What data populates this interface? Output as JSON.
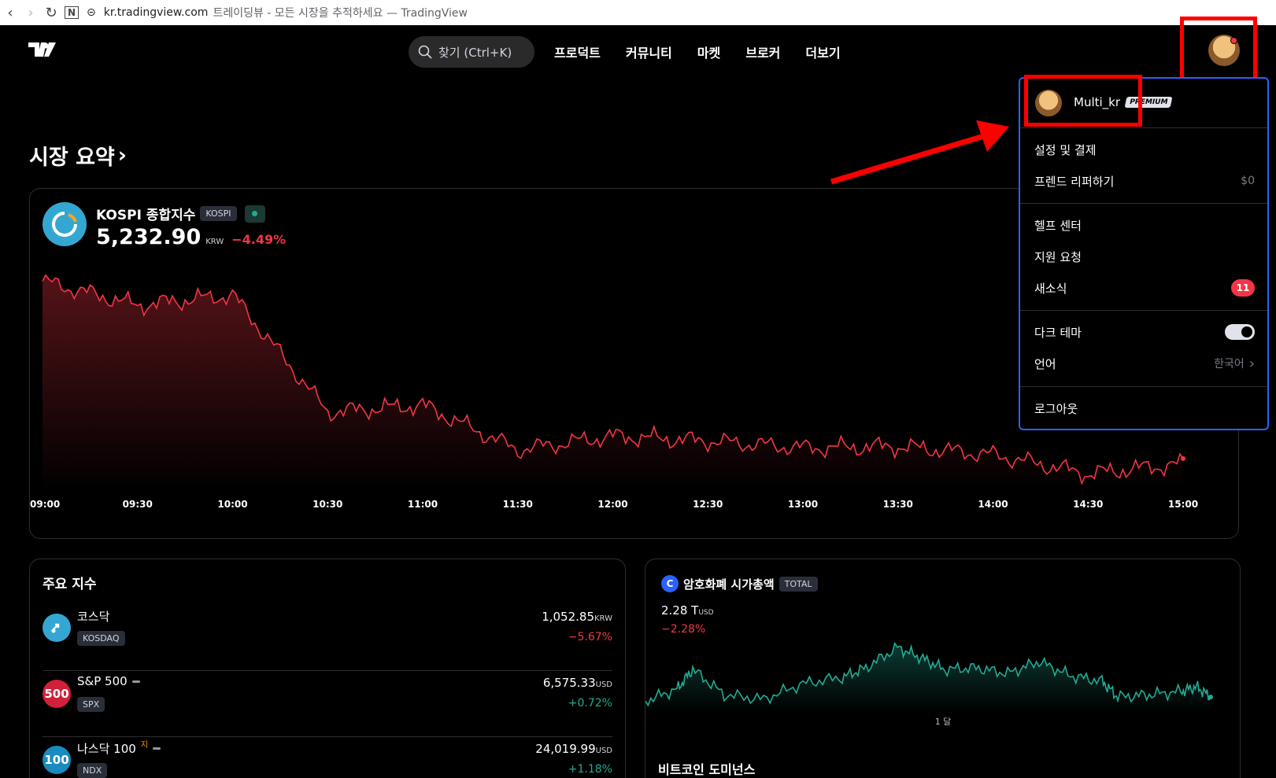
{
  "browser": {
    "domain": "kr.tradingview.com",
    "title": "트레이딩뷰 - 모든 시장을 추적하세요 — TradingView"
  },
  "nav": {
    "search_placeholder": "찾기 (Ctrl+K)",
    "links": [
      "프로덕트",
      "커뮤니티",
      "마켓",
      "브로커",
      "더보기"
    ]
  },
  "page": {
    "title": "시장 요약",
    "title_chevron": "›"
  },
  "main_index": {
    "name": "KOSPI 종합지수",
    "ticker": "KOSPI",
    "price": "5,232.90",
    "currency": "KRW",
    "change": "−4.49%"
  },
  "chart_data": [
    {
      "type": "area",
      "name": "KOSPI intraday",
      "x": [
        "09:00",
        "09:30",
        "10:00",
        "10:30",
        "11:00",
        "11:30",
        "12:00",
        "12:30",
        "13:00",
        "13:30",
        "14:00",
        "14:30",
        "15:00"
      ],
      "y": [
        5480,
        5445,
        5460,
        5290,
        5300,
        5235,
        5255,
        5248,
        5238,
        5240,
        5228,
        5200,
        5215
      ],
      "color": "#f23645"
    },
    {
      "type": "area",
      "name": "Crypto total market cap",
      "x_label": "1 달",
      "color": "#22ab94"
    }
  ],
  "indices": {
    "title": "주요 지수",
    "rows": [
      {
        "name": "코스닥",
        "ticker": "KOSDAQ",
        "price": "1,052.85",
        "currency": "KRW",
        "change": "−5.67%",
        "dir": "neg",
        "icon_text": "",
        "icon_color": "#33a7d2"
      },
      {
        "name": "S&P 500",
        "ticker": "SPX",
        "price": "6,575.33",
        "currency": "USD",
        "change": "+0.72%",
        "dir": "pos",
        "icon_text": "500",
        "icon_color": "#d1203a"
      },
      {
        "name": "나스닥 100",
        "ticker": "NDX",
        "price": "24,019.99",
        "currency": "USD",
        "change": "+1.18%",
        "dir": "pos",
        "icon_text": "100",
        "icon_color": "#1a8bbf",
        "sup": "지"
      }
    ]
  },
  "crypto": {
    "title": "암호화폐 시가총액",
    "ticker": "TOTAL",
    "value": "2.28 T",
    "currency": "USD",
    "change": "−2.28%",
    "period": "1 달",
    "next_section": "비트코인 도미넌스"
  },
  "menu": {
    "username": "Multi_kr",
    "plan": "PREMIUM",
    "items": [
      {
        "label": "설정 및 결제",
        "right": ""
      },
      {
        "label": "프렌드 리퍼하기",
        "right": "$0"
      },
      {
        "label": "헬프 센터",
        "right": ""
      },
      {
        "label": "지원 요청",
        "right": ""
      },
      {
        "label": "새소식",
        "right": "",
        "count": "11"
      },
      {
        "label": "다크 테마",
        "right": ""
      },
      {
        "label": "언어",
        "right": "한국어"
      },
      {
        "label": "로그아웃",
        "right": ""
      }
    ]
  },
  "colors": {
    "accent": "#2962ff",
    "negative": "#f23645",
    "positive": "#22ab94",
    "annotation": "#ff0000"
  }
}
